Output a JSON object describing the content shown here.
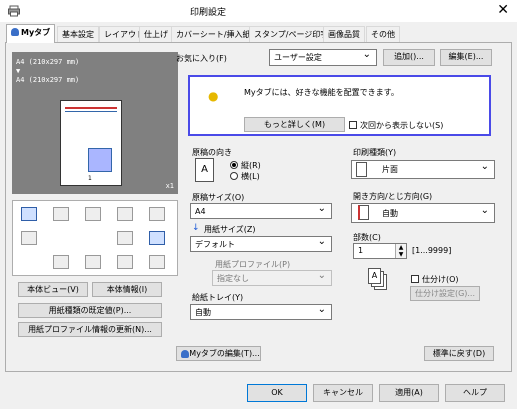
{
  "window": {
    "title": "印刷設定",
    "close_glyph": "✕"
  },
  "tabs": [
    {
      "label": "Myタブ"
    },
    {
      "label": "基本設定"
    },
    {
      "label": "レイアウト"
    },
    {
      "label": "仕上げ"
    },
    {
      "label": "カバーシート/挿入紙"
    },
    {
      "label": "スタンプ/ページ印字"
    },
    {
      "label": "画像品質"
    },
    {
      "label": "その他"
    }
  ],
  "preview": {
    "line1": "A4 (210x297 mm)",
    "arrow": "▼",
    "line2": "A4 (210x297 mm)",
    "page_number": "1",
    "copies": "x1"
  },
  "left_buttons": {
    "body_view": "本体ビュー(V)",
    "body_info": "本体情報(I)",
    "paper_default": "用紙種類の既定値(P)...",
    "paper_profile_update": "用紙プロファイル情報の更新(N)..."
  },
  "favorites": {
    "label": "お気に入り(F)",
    "value": "ユーザー設定",
    "add": "追加()...",
    "edit": "編集(E)..."
  },
  "info": {
    "message": "Myタブには、好きな機能を配置できます。",
    "more": "もっと詳しく(M)",
    "dont_show": "次回から表示しない(S)"
  },
  "orientation": {
    "label": "原稿の向き",
    "portrait": "縦(R)",
    "landscape": "横(L)"
  },
  "original_size": {
    "label": "原稿サイズ(O)",
    "value": "A4"
  },
  "paper_size": {
    "label": "用紙サイズ(Z)",
    "value": "デフォルト"
  },
  "paper_profile": {
    "label": "用紙プロファイル(P)",
    "value": "指定なし"
  },
  "tray": {
    "label": "給紙トレイ(Y)",
    "value": "自動"
  },
  "print_type": {
    "label": "印刷種類(Y)",
    "value": "片面"
  },
  "binding": {
    "label": "開き方向/とじ方向(G)",
    "value": "自動"
  },
  "copies": {
    "label": "部数(C)",
    "value": "1",
    "range": "[1...9999]"
  },
  "collate": {
    "label": "仕分け(O)",
    "settings": "仕分け設定(G)..."
  },
  "edit_mytab": "Myタブの編集(T)...",
  "restore_default": "標準に戻す(D)",
  "footer": {
    "ok": "OK",
    "cancel": "キャンセル",
    "apply": "適用(A)",
    "help": "ヘルプ"
  }
}
